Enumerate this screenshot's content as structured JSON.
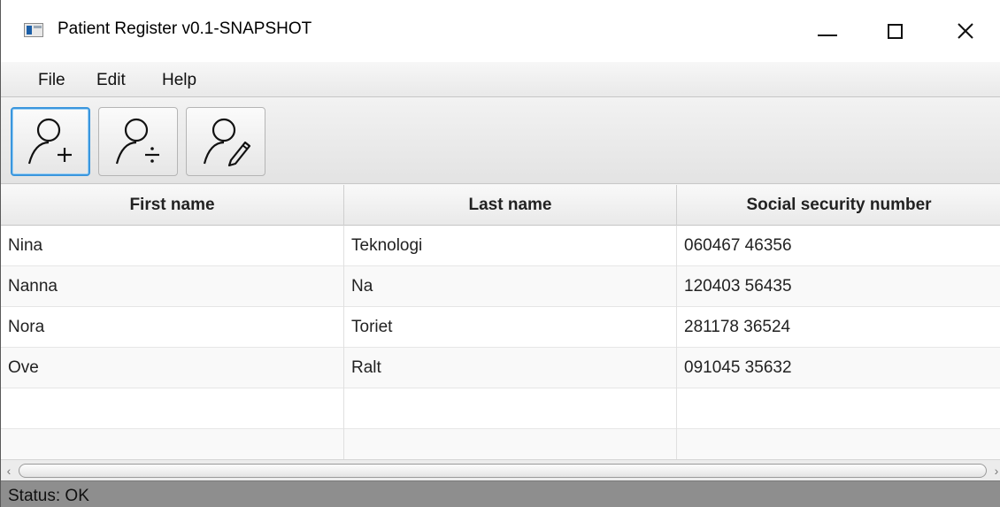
{
  "window": {
    "title": "Patient Register v0.1-SNAPSHOT",
    "app_icon": "window-app-icon",
    "controls": {
      "minimize_icon": "minimize-icon",
      "maximize_icon": "maximize-icon",
      "close_icon": "close-icon",
      "close_glyph": "✕"
    }
  },
  "menubar": {
    "items": [
      {
        "label": "File"
      },
      {
        "label": "Edit"
      },
      {
        "label": "Help"
      }
    ]
  },
  "toolbar": {
    "buttons": [
      {
        "icon": "add-person-icon",
        "selected": true
      },
      {
        "icon": "remove-person-icon",
        "selected": false
      },
      {
        "icon": "edit-person-icon",
        "selected": false
      }
    ]
  },
  "table": {
    "columns": [
      "First name",
      "Last name",
      "Social security number"
    ],
    "rows": [
      [
        "Nina",
        "Teknologi",
        "060467 46356"
      ],
      [
        "Nanna",
        "Na",
        "120403 56435"
      ],
      [
        "Nora",
        "Toriet",
        "281178 36524"
      ],
      [
        "Ove",
        "Ralt",
        "091045 35632"
      ],
      [
        "",
        "",
        ""
      ],
      [
        "",
        "",
        ""
      ]
    ]
  },
  "scrollbar": {
    "left_arrow": "‹",
    "right_arrow": "›"
  },
  "status": {
    "text": "Status: OK"
  },
  "colors": {
    "focus_accent": "#3a96dd",
    "status_bar": "#8e8e8e"
  }
}
